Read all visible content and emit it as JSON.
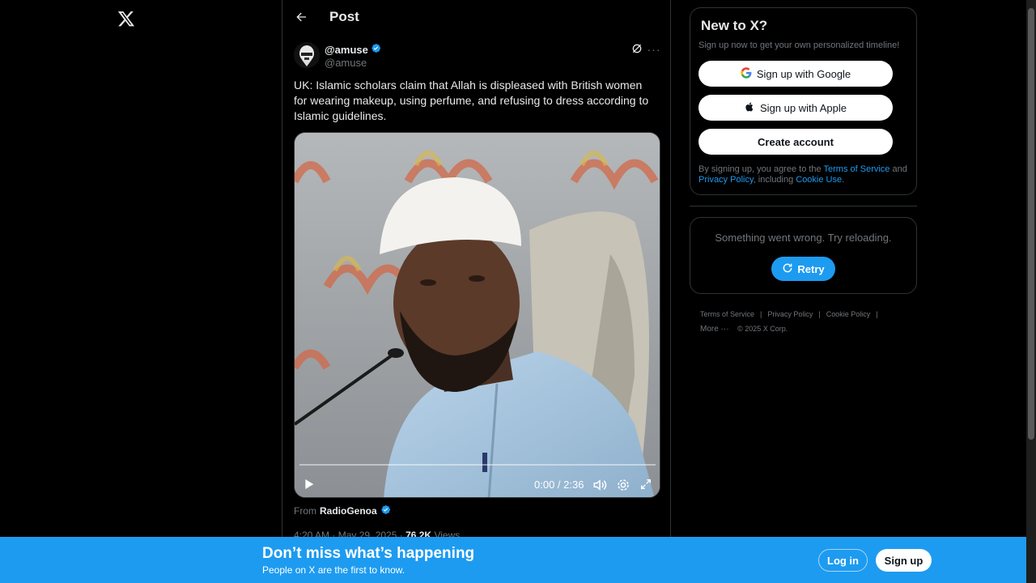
{
  "header": {
    "title": "Post"
  },
  "post": {
    "author_name": "@amuse",
    "author_handle": "@amuse",
    "text": "UK: Islamic scholars claim that Allah is displeased with British women for wearing makeup, using perfume, and refusing to dress according to Islamic guidelines.",
    "video": {
      "time": "0:00 / 2:36",
      "progress": 0.0
    },
    "from_label": "From",
    "from_name": "RadioGenoa",
    "meta_time": "4:20 AM · May 29, 2025 · ",
    "meta_views_count": "76.2K",
    "meta_views_label": " Views"
  },
  "signup_card": {
    "title": "New to X?",
    "subtitle": "Sign up now to get your own personalized timeline!",
    "google_label": "Sign up with Google",
    "apple_label": "Sign up with Apple",
    "create_label": "Create account",
    "legal_prefix": "By signing up, you agree to the ",
    "legal_tos": "Terms of Service",
    "legal_and": " and ",
    "legal_privacy": "Privacy Policy",
    "legal_including": ", including ",
    "legal_cookie": "Cookie Use",
    "legal_end": "."
  },
  "error_card": {
    "message": "Something went wrong. Try reloading.",
    "retry_label": "Retry"
  },
  "footer": {
    "tos": "Terms of Service",
    "privacy": "Privacy Policy",
    "cookie": "Cookie Policy",
    "more": "More ···",
    "copyright": "© 2025 X Corp."
  },
  "banner": {
    "title": "Don’t miss what’s happening",
    "subtitle": "People on X are the first to know.",
    "login_label": "Log in",
    "signup_label": "Sign up"
  },
  "colors": {
    "accent": "#1d9bf0",
    "background": "#000000",
    "border": "#2f3336",
    "muted_text": "#71767b"
  }
}
